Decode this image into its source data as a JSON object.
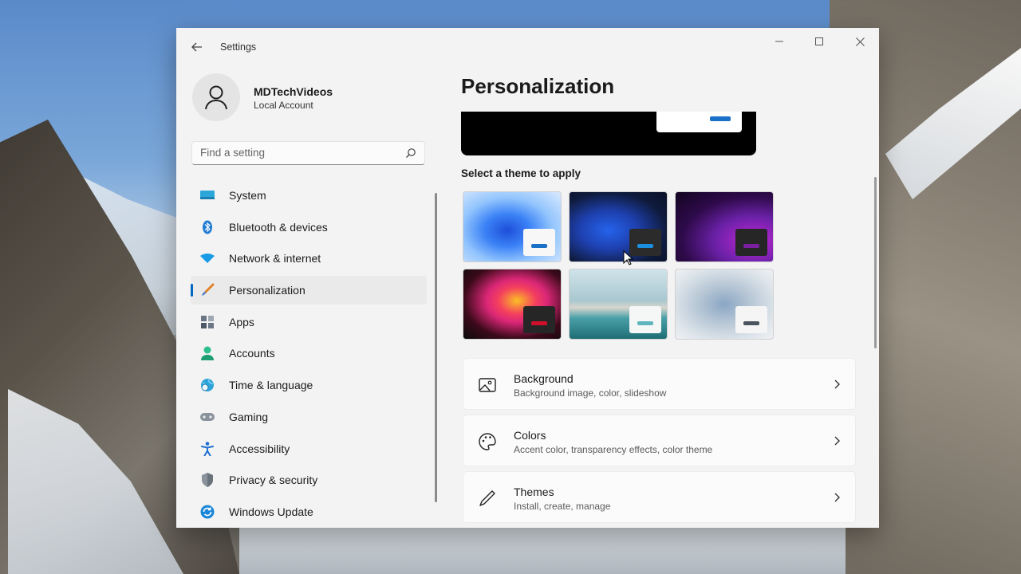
{
  "window": {
    "title": "Settings"
  },
  "profile": {
    "name": "MDTechVideos",
    "account_type": "Local Account"
  },
  "search": {
    "placeholder": "Find a setting"
  },
  "nav": {
    "items": [
      {
        "label": "System",
        "icon": "monitor-icon"
      },
      {
        "label": "Bluetooth & devices",
        "icon": "bluetooth-icon"
      },
      {
        "label": "Network & internet",
        "icon": "wifi-icon"
      },
      {
        "label": "Personalization",
        "icon": "brush-icon",
        "selected": true
      },
      {
        "label": "Apps",
        "icon": "apps-icon"
      },
      {
        "label": "Accounts",
        "icon": "person-icon"
      },
      {
        "label": "Time & language",
        "icon": "globe-clock-icon"
      },
      {
        "label": "Gaming",
        "icon": "gamepad-icon"
      },
      {
        "label": "Accessibility",
        "icon": "accessibility-icon"
      },
      {
        "label": "Privacy & security",
        "icon": "shield-icon"
      },
      {
        "label": "Windows Update",
        "icon": "update-icon"
      }
    ]
  },
  "main": {
    "title": "Personalization",
    "theme_section_label": "Select a theme to apply",
    "themes": [
      {
        "name": "windows-light",
        "accent": "#1a6fc6"
      },
      {
        "name": "windows-dark",
        "accent": "#1a8fe0"
      },
      {
        "name": "glow",
        "accent": "#7a1fa0"
      },
      {
        "name": "captured-motion",
        "accent": "#d0102a"
      },
      {
        "name": "sunrise",
        "accent": "#5fb5bd"
      },
      {
        "name": "flow",
        "accent": "#4a5560"
      }
    ],
    "settings": [
      {
        "title": "Background",
        "subtitle": "Background image, color, slideshow",
        "icon": "image-icon"
      },
      {
        "title": "Colors",
        "subtitle": "Accent color, transparency effects, color theme",
        "icon": "palette-icon"
      },
      {
        "title": "Themes",
        "subtitle": "Install, create, manage",
        "icon": "pen-icon"
      }
    ]
  },
  "colors": {
    "accent": "#0067c0",
    "window_bg": "#f3f3f3"
  }
}
